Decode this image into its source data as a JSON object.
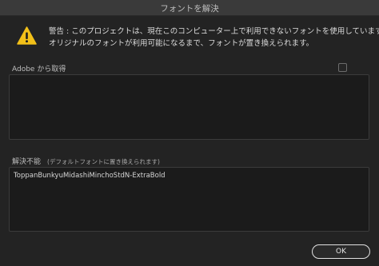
{
  "window": {
    "title": "フォントを解決"
  },
  "warning": {
    "line1": "警告 : このプロジェクトは、現在このコンピューター上で利用できないフォントを使用しています。",
    "line2": "オリジナルのフォントが利用可能になるまで、フォントが置き換えられます。"
  },
  "adobe_section": {
    "label": "Adobe から取得",
    "checked": false,
    "items": []
  },
  "unresolved_section": {
    "label": "解決不能",
    "sublabel": "(デフォルトフォントに置き換えられます)",
    "items": [
      "ToppanBunkyuMidashiMinchoStdN-ExtraBold"
    ]
  },
  "buttons": {
    "ok": "OK"
  },
  "colors": {
    "warning_icon": "#f2c019",
    "background": "#232323"
  }
}
